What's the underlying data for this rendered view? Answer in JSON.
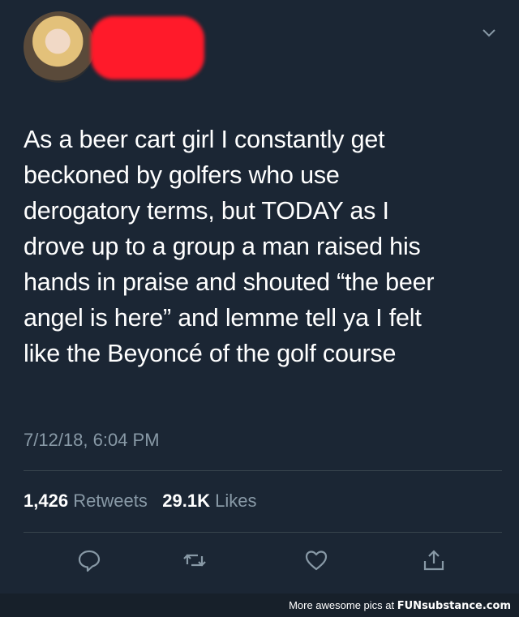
{
  "tweet": {
    "text": "As a beer cart girl I constantly get\nbeckoned by golfers who use\nderogatory terms, but TODAY as I\ndrove up to a group a man raised his\nhands in praise and shouted “the beer\nangel is here” and lemme tell ya I felt\nlike the Beyoncé of the golf course",
    "timestamp": "7/12/18, 6:04 PM"
  },
  "stats": {
    "retweets_count": "1,426",
    "retweets_label": "Retweets",
    "likes_count": "29.1K",
    "likes_label": "Likes"
  },
  "icons": {
    "reply": "reply-icon",
    "retweet": "retweet-icon",
    "like": "heart-icon",
    "share": "share-icon",
    "menu": "chevron-down-icon"
  },
  "footer": {
    "text": "More awesome pics at",
    "brand": "FUNsubstance.com"
  },
  "colors": {
    "background": "#1b2634",
    "muted": "#8899a6",
    "redaction": "#ff1a2a"
  }
}
